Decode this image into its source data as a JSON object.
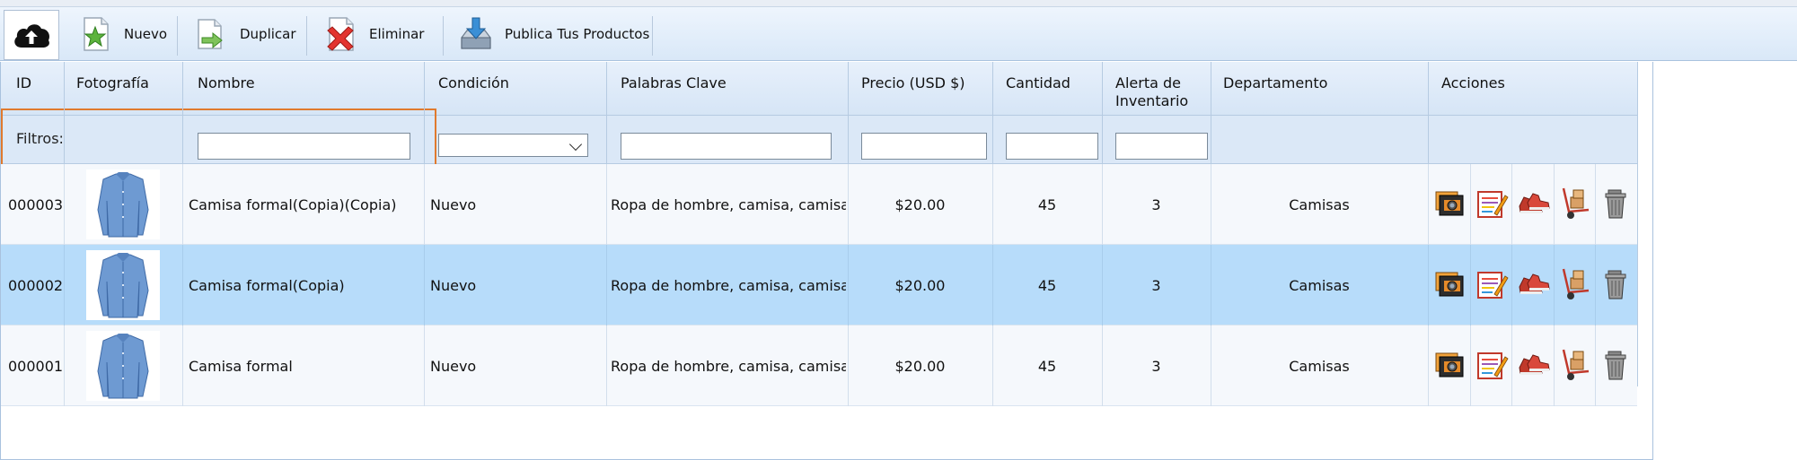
{
  "toolbar": {
    "upload_icon": "cloud-upload-icon",
    "buttons": [
      {
        "label": "Nuevo",
        "icon": "star-icon"
      },
      {
        "label": "Duplicar",
        "icon": "duplicate-icon"
      },
      {
        "label": "Eliminar",
        "icon": "delete-icon"
      },
      {
        "label": "Publica Tus Productos",
        "icon": "publish-icon"
      }
    ]
  },
  "table": {
    "headers": {
      "id": "ID",
      "photo": "Fotografía",
      "name": "Nombre",
      "condition": "Condición",
      "keywords": "Palabras Clave",
      "price": "Precio (USD $)",
      "quantity": "Cantidad",
      "alert": "Alerta de Inventario",
      "department": "Departamento",
      "actions": "Acciones"
    },
    "filters_label": "Filtros:",
    "filters": {
      "name": "",
      "condition": "",
      "keywords": "",
      "price": "",
      "quantity": "",
      "alert": ""
    },
    "rows": [
      {
        "id": "000003",
        "name": "Camisa formal(Copia)(Copia)",
        "condition": "Nuevo",
        "keywords": "Ropa de hombre, camisa, camisa for",
        "price": "$20.00",
        "quantity": "45",
        "alert": "3",
        "department": "Camisas",
        "selected": false
      },
      {
        "id": "000002",
        "name": "Camisa formal(Copia)",
        "condition": "Nuevo",
        "keywords": "Ropa de hombre, camisa, camisa for",
        "price": "$20.00",
        "quantity": "45",
        "alert": "3",
        "department": "Camisas",
        "selected": true
      },
      {
        "id": "000001",
        "name": "Camisa formal",
        "condition": "Nuevo",
        "keywords": "Ropa de hombre, camisa, camisa for",
        "price": "$20.00",
        "quantity": "45",
        "alert": "3",
        "department": "Camisas",
        "selected": false
      }
    ],
    "action_icons": [
      "photos-icon",
      "edit-icon",
      "shoes-icon",
      "hand-truck-icon",
      "trash-icon"
    ]
  },
  "colors": {
    "selected_row": "#b7dcfa",
    "header": "#dbe8f7",
    "filter_highlight": "#e07a2e"
  }
}
